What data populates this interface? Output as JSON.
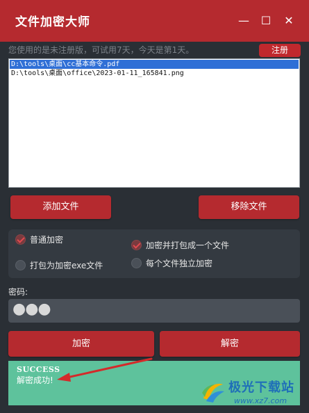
{
  "window": {
    "title": "文件加密大师",
    "minimize": "—",
    "maximize": "☐",
    "close": "✕"
  },
  "notice": {
    "text": "您使用的是未注册版，可试用7天，今天是第1天。",
    "register_label": "注册"
  },
  "file_list": {
    "items": [
      {
        "path": "D:\\tools\\桌面\\cc基本命令.pdf",
        "selected": true
      },
      {
        "path": "D:\\tools\\桌面\\office\\2023-01-11_165841.png",
        "selected": false
      }
    ]
  },
  "buttons": {
    "add_file": "添加文件",
    "remove_file": "移除文件",
    "encrypt": "加密",
    "decrypt": "解密"
  },
  "options": {
    "normal_encrypt": "普通加密",
    "pack_exe": "打包为加密exe文件",
    "pack_one_file": "加密并打包成一个文件",
    "each_separate": "每个文件独立加密"
  },
  "password": {
    "label": "密码:",
    "value": "●●●"
  },
  "status": {
    "title": "SUCCESS",
    "message": "解密成功!"
  },
  "watermark": {
    "title": "极光下载站",
    "url": "www.xz7.com"
  },
  "colors": {
    "accent": "#b52a2f",
    "background": "#2a2f35",
    "success": "#5ec29c",
    "selection": "#2f6fd6",
    "arrow": "#d42a2a"
  }
}
